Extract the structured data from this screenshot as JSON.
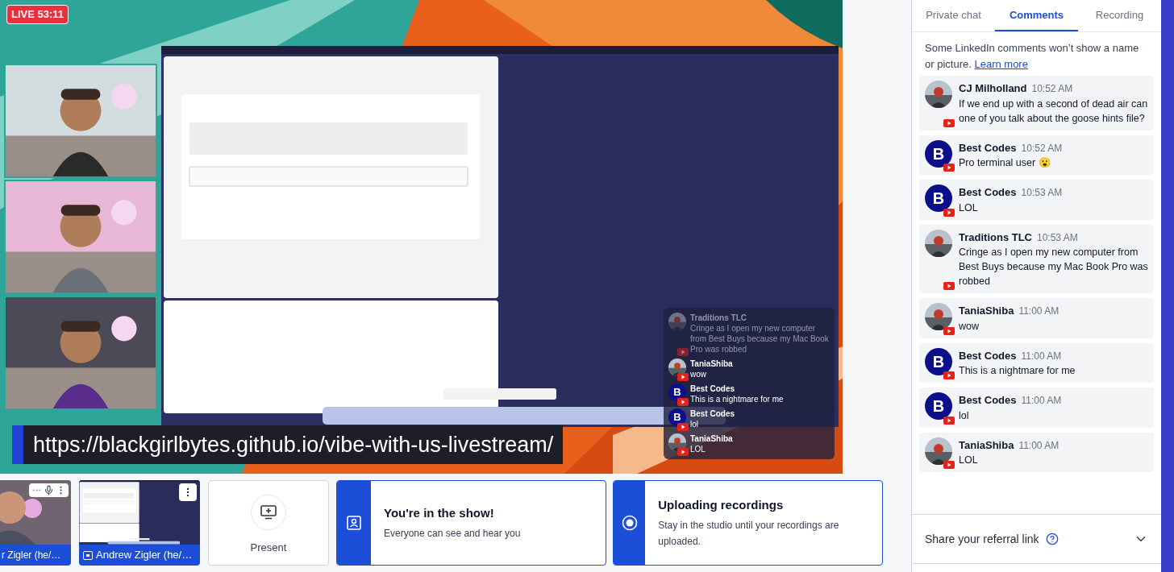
{
  "stage": {
    "live_badge": "LIVE 53:11",
    "banner_url": "https://blackgirlbytes.github.io/vibe-with-us-livestream/",
    "overlay_comments": [
      {
        "author": "Traditions TLC",
        "text": "Cringe as I open my new computer from Best Buys because my Mac Book Pro was robbed",
        "kind": "picture",
        "faded": true
      },
      {
        "author": "TaniaShiba",
        "text": "wow",
        "kind": "picture",
        "faded": false
      },
      {
        "author": "Best Codes",
        "text": "This is a nightmare for me",
        "kind": "letter",
        "avatar_letter": "B",
        "faded": false
      },
      {
        "author": "Best Codes",
        "text": "lol",
        "kind": "letter",
        "avatar_letter": "B",
        "faded": false
      },
      {
        "author": "TaniaShiba",
        "text": "LOL",
        "kind": "picture",
        "faded": false
      }
    ]
  },
  "filmstrip": [
    {
      "kind": "camera",
      "name": "r Zigler (he/…"
    },
    {
      "kind": "screen",
      "name": "Andrew Zigler (he/…"
    },
    {
      "kind": "present",
      "label": "Present"
    }
  ],
  "status_cards": [
    {
      "kind": "show",
      "title": "You're in the show!",
      "text": "Everyone can see and hear you"
    },
    {
      "kind": "recording",
      "title": "Uploading recordings",
      "text": "Stay in the studio until your recordings are uploaded."
    }
  ],
  "sidebar": {
    "tabs": [
      {
        "label": "Private chat",
        "selected": false
      },
      {
        "label": "Comments",
        "selected": true
      },
      {
        "label": "Recording",
        "selected": false
      }
    ],
    "notice": "Some LinkedIn comments won’t show a name or picture.",
    "notice_link": "Learn more",
    "comments": [
      {
        "author": "CJ Milholland",
        "time": "10:52 AM",
        "text": "If we end up with a second of dead air can one of you talk about the goose hints file?",
        "kind": "picture"
      },
      {
        "author": "Best Codes",
        "time": "10:52 AM",
        "text": "Pro terminal user 😮",
        "kind": "letter",
        "avatar_letter": "B"
      },
      {
        "author": "Best Codes",
        "time": "10:53 AM",
        "text": "LOL",
        "kind": "letter",
        "avatar_letter": "B"
      },
      {
        "author": "Traditions TLC",
        "time": "10:53 AM",
        "text": "Cringe as I open my new computer from Best Buys because my Mac Book Pro was robbed",
        "kind": "picture"
      },
      {
        "author": "TaniaShiba",
        "time": "11:00 AM",
        "text": "wow",
        "kind": "picture"
      },
      {
        "author": "Best Codes",
        "time": "11:00 AM",
        "text": "This is a nightmare for me",
        "kind": "letter",
        "avatar_letter": "B"
      },
      {
        "author": "Best Codes",
        "time": "11:00 AM",
        "text": "lol",
        "kind": "letter",
        "avatar_letter": "B"
      },
      {
        "author": "TaniaShiba",
        "time": "11:00 AM",
        "text": "LOL",
        "kind": "picture"
      }
    ],
    "referral": "Share your referral link"
  }
}
